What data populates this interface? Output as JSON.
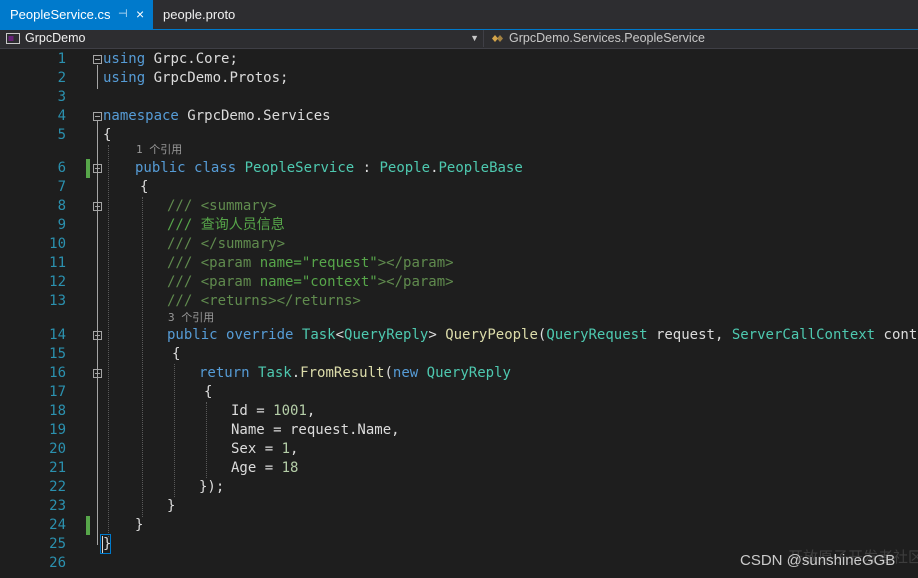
{
  "tabs": [
    {
      "label": "PeopleService.cs",
      "active": true,
      "pin_icon": "pin-icon",
      "close_icon": "close-icon"
    },
    {
      "label": "people.proto",
      "active": false
    }
  ],
  "nav": {
    "project": "GrpcDemo",
    "class_path": "GrpcDemo.Services.PeopleService"
  },
  "line_numbers": [
    "1",
    "2",
    "3",
    "4",
    "5",
    "6",
    "7",
    "8",
    "9",
    "10",
    "11",
    "12",
    "13",
    "14",
    "15",
    "16",
    "17",
    "18",
    "19",
    "20",
    "21",
    "22",
    "23",
    "24",
    "25",
    "26"
  ],
  "code_lines": [
    {
      "n": 1,
      "parts": [
        [
          "kw",
          "using"
        ],
        [
          "",
          " Grpc.Core;"
        ]
      ]
    },
    {
      "n": 2,
      "parts": [
        [
          "kw",
          "using"
        ],
        [
          "",
          " GrpcDemo.Protos;"
        ]
      ]
    },
    {
      "n": 3,
      "parts": []
    },
    {
      "n": 4,
      "parts": [
        [
          "kw",
          "namespace"
        ],
        [
          "",
          " GrpcDemo.Services"
        ]
      ]
    },
    {
      "n": 5,
      "parts": [
        [
          "",
          "{"
        ]
      ]
    },
    {
      "n": 6,
      "parts": [
        [
          "kw",
          "public"
        ],
        [
          "",
          " "
        ],
        [
          "kw",
          "class"
        ],
        [
          "",
          " "
        ],
        [
          "ty",
          "PeopleService"
        ],
        [
          "",
          " : "
        ],
        [
          "ty",
          "People"
        ],
        [
          "",
          "."
        ],
        [
          "ty",
          "PeopleBase"
        ]
      ]
    },
    {
      "n": 7,
      "parts": [
        [
          "",
          "{"
        ]
      ]
    },
    {
      "n": 8,
      "parts": [
        [
          "xm",
          "/// <summary>"
        ]
      ]
    },
    {
      "n": 9,
      "parts": [
        [
          "cm",
          "/// 查询人员信息"
        ]
      ]
    },
    {
      "n": 10,
      "parts": [
        [
          "xm",
          "/// </summary>"
        ]
      ]
    },
    {
      "n": 11,
      "parts": [
        [
          "xm",
          "/// <param "
        ],
        [
          "cm",
          "name=\"request\""
        ],
        [
          "xm",
          "></param>"
        ]
      ]
    },
    {
      "n": 12,
      "parts": [
        [
          "xm",
          "/// <param "
        ],
        [
          "cm",
          "name=\"context\""
        ],
        [
          "xm",
          "></param>"
        ]
      ]
    },
    {
      "n": 13,
      "parts": [
        [
          "xm",
          "/// <returns></returns>"
        ]
      ]
    },
    {
      "n": 14,
      "parts": [
        [
          "kw",
          "public"
        ],
        [
          "",
          " "
        ],
        [
          "kw",
          "override"
        ],
        [
          "",
          " "
        ],
        [
          "ty",
          "Task"
        ],
        [
          "",
          "<"
        ],
        [
          "ty",
          "QueryReply"
        ],
        [
          "",
          "> "
        ],
        [
          "mt",
          "QueryPeople"
        ],
        [
          "",
          "("
        ],
        [
          "ty",
          "QueryRequest"
        ],
        [
          "",
          " request, "
        ],
        [
          "ty",
          "ServerCallContext"
        ],
        [
          "",
          " context)"
        ]
      ]
    },
    {
      "n": 15,
      "parts": [
        [
          "",
          "{"
        ]
      ]
    },
    {
      "n": 16,
      "parts": [
        [
          "kw",
          "return"
        ],
        [
          "",
          " "
        ],
        [
          "ty",
          "Task"
        ],
        [
          "",
          "."
        ],
        [
          "mt",
          "FromResult"
        ],
        [
          "",
          "("
        ],
        [
          "kw",
          "new"
        ],
        [
          "",
          " "
        ],
        [
          "ty",
          "QueryReply"
        ]
      ]
    },
    {
      "n": 17,
      "parts": [
        [
          "",
          "{"
        ]
      ]
    },
    {
      "n": 18,
      "parts": [
        [
          "",
          "Id = "
        ],
        [
          "nu",
          "1001"
        ],
        [
          "",
          ","
        ]
      ]
    },
    {
      "n": 19,
      "parts": [
        [
          "",
          "Name = request.Name,"
        ]
      ]
    },
    {
      "n": 20,
      "parts": [
        [
          "",
          "Sex = "
        ],
        [
          "nu",
          "1"
        ],
        [
          "",
          ","
        ]
      ]
    },
    {
      "n": 21,
      "parts": [
        [
          "",
          "Age = "
        ],
        [
          "nu",
          "18"
        ]
      ]
    },
    {
      "n": 22,
      "parts": [
        [
          "",
          "});"
        ]
      ]
    },
    {
      "n": 23,
      "parts": [
        [
          "",
          "}"
        ]
      ]
    },
    {
      "n": 24,
      "parts": [
        [
          "",
          "}"
        ]
      ]
    },
    {
      "n": 25,
      "parts": [
        [
          "",
          "}"
        ]
      ]
    },
    {
      "n": 26,
      "parts": []
    }
  ],
  "codelens": [
    {
      "before_line": 6,
      "text": "1 个引用"
    },
    {
      "before_line": 14,
      "text": "3 个引用"
    }
  ],
  "watermark": "CSDN @sunshineGGB",
  "watermark_faint": "开放原子开发者社区",
  "colors": {
    "background": "#1e1e1e",
    "accent": "#007acc",
    "keyword": "#569cd6",
    "type": "#4ec9b0",
    "comment": "#57a64a",
    "line_number": "#2b91af"
  }
}
